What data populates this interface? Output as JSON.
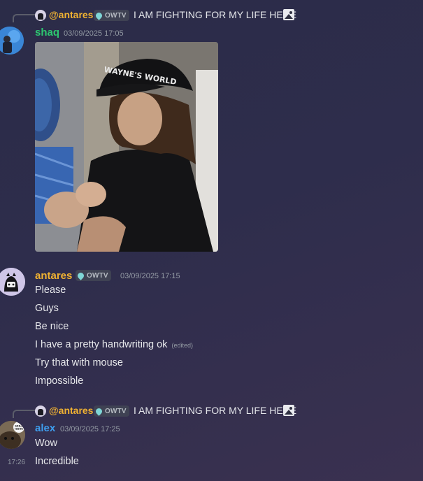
{
  "reply1": {
    "name": "@antares",
    "tag": "OWTV",
    "text": "I AM FIGHTING FOR MY LIFE HERE"
  },
  "msg_shaq": {
    "username": "shaq",
    "username_color": "#2dc770",
    "timestamp": "03/09/2025 17:05",
    "gif_cap_text": "WAYNE'S WORLD"
  },
  "msg_antares": {
    "username": "antares",
    "username_color": "#f0b232",
    "tag": "OWTV",
    "timestamp": "03/09/2025 17:15",
    "lines": [
      "Please",
      "Guys",
      "Be nice",
      "I have a pretty handwriting ok",
      "Try that with mouse",
      "Impossible"
    ],
    "edited": "(edited)"
  },
  "reply2": {
    "name": "@antares",
    "tag": "OWTV",
    "text": "I AM FIGHTING FOR MY LIFE HERE"
  },
  "msg_alex": {
    "username": "alex",
    "username_color": "#3e9ded",
    "timestamp": "03/09/2025 17:25",
    "avatar_badge": "SKILL ISSUE",
    "lines": [
      "Wow",
      "Incredible"
    ],
    "hover_time": "17:26"
  }
}
